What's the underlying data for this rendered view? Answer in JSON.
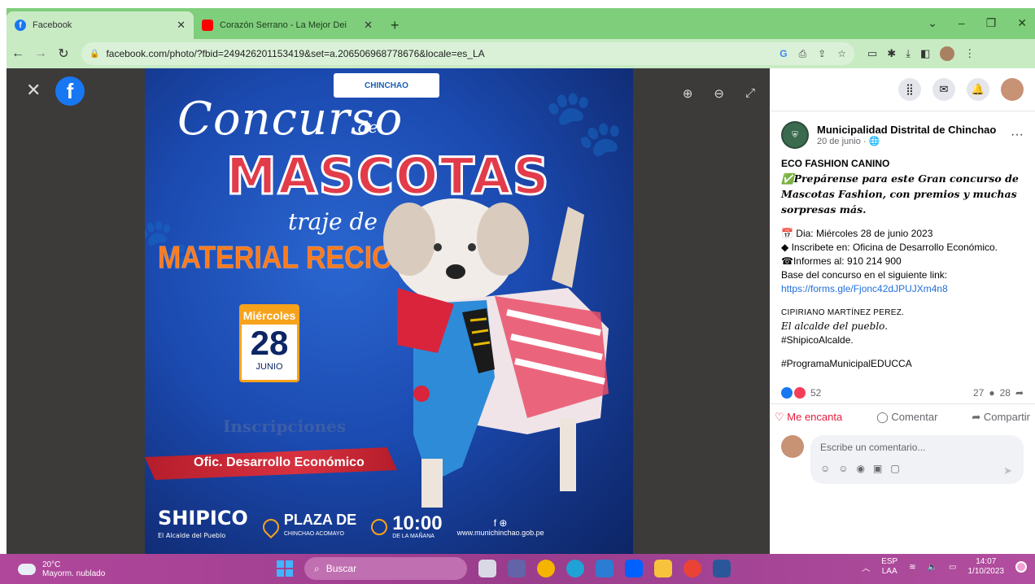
{
  "browser": {
    "tabs": [
      {
        "title": "Facebook",
        "active": true,
        "favicon": "facebook-icon",
        "color": "#1877f2"
      },
      {
        "title": "Corazón Serrano - La Mejor Dei",
        "active": false,
        "favicon": "youtube-icon",
        "color": "#ff0000"
      }
    ],
    "new_tab_label": "+",
    "url": "facebook.com/photo/?fbid=249426201153419&set=a.206506968778676&locale=es_LA"
  },
  "viewer": {
    "poster": {
      "org_logo": "CHINCHAO",
      "title_script": "Concurso",
      "title_de": "de",
      "title_main": "MASCOTAS",
      "subtitle": "traje de",
      "material": "MATERIAL RECICLADO",
      "day_of_week": "Miércoles",
      "day": "28",
      "month": "JUNIO",
      "inscripciones": "Inscripciones",
      "office": "Ofic. Desarrollo Económico",
      "brand": "SHIPICO",
      "brand_tagline": "El Alcalde del Pueblo",
      "place": "PLAZA DE",
      "place_sub": "CHINCHAO ACOMAYO",
      "time": "10:00",
      "time_sub": "DE LA MAÑANA",
      "social_text": "www.munichinchao.gob.pe"
    }
  },
  "post": {
    "author": "Municipalidad Distrital de Chinchao",
    "date": "20 de junio · ",
    "lines": {
      "title": "ECO FASHION CANINO",
      "intro": "✅Prepárense para este Gran concurso de Mascotas Fashion, con premios y muchas sorpresas más.",
      "dia": "📅 Dia: Miércoles 28 de junio 2023",
      "inscribete": "◆ Inscribete en: Oficina de Desarrollo Económico.",
      "informes": "☎Informes al: 910 214 900",
      "base": "Base del concurso en el siguiente link:",
      "link": "https://forms.gle/Fjonc42dJPUJXm4n8",
      "sign1": "CIPIRIANO MARTÍNEZ PEREZ.",
      "sign2": "El alcalde del pueblo.",
      "sign3": "#ShipicoAlcalde.",
      "hashtag": "#ProgramaMunicipalEDUCCA"
    },
    "reactions_count": "52",
    "comments_count": "27",
    "shares_count": "28",
    "actions": {
      "love": "Me encanta",
      "comment": "Comentar",
      "share": "Compartir"
    },
    "comment_placeholder": "Escribe un comentario..."
  },
  "taskbar": {
    "temperature": "20°C",
    "weather": "Mayorm. nublado",
    "search_label": "Buscar",
    "lang_top": "ESP",
    "lang_bottom": "LAA",
    "time": "14:07",
    "date": "1/10/2023"
  }
}
